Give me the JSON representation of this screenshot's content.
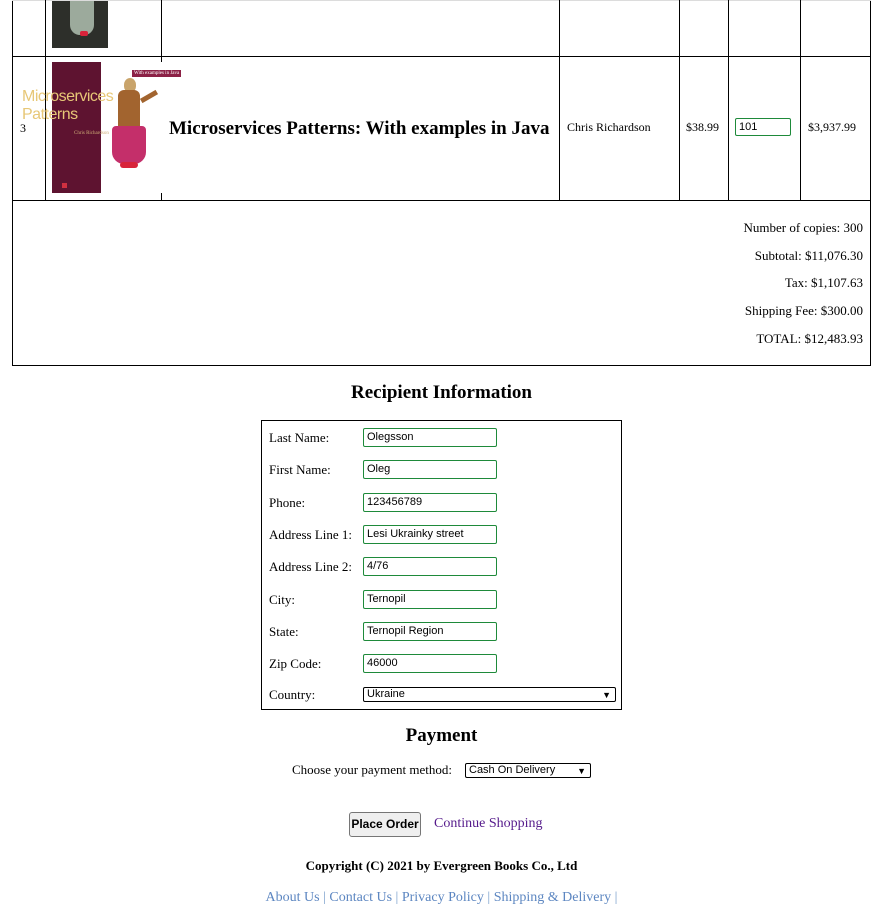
{
  "cart": {
    "items": [
      {
        "index": "3",
        "title": "Microservices Patterns: With examples in Java",
        "author": "Chris Richardson",
        "price": "$38.99",
        "quantity": "101",
        "subtotal": "$3,937.99",
        "cover": {
          "title_line1": "Microservices",
          "title_line2": "Patterns",
          "author": "Chris Richardson",
          "tagline": "With examples in Java",
          "colors": {
            "background": "#5e1330",
            "title": "#e7c777"
          }
        }
      }
    ],
    "totals": {
      "copies": "Number of copies: 300",
      "subtotal": "Subtotal: $11,076.30",
      "tax": "Tax: $1,107.63",
      "shipping": "Shipping Fee: $300.00",
      "total": "TOTAL: $12,483.93"
    }
  },
  "recipient": {
    "title": "Recipient Information",
    "fields": [
      {
        "label": "Last Name:",
        "value": "Olegsson"
      },
      {
        "label": "First Name:",
        "value": "Oleg"
      },
      {
        "label": "Phone:",
        "value": "123456789"
      },
      {
        "label": "Address Line 1:",
        "value": "Lesi Ukrainky street"
      },
      {
        "label": "Address Line 2:",
        "value": "4/76"
      },
      {
        "label": "City:",
        "value": "Ternopil"
      },
      {
        "label": "State:",
        "value": "Ternopil Region"
      },
      {
        "label": "Zip Code:",
        "value": "46000"
      }
    ],
    "country": {
      "label": "Country:",
      "value": "Ukraine"
    }
  },
  "payment": {
    "title": "Payment",
    "method_label": "Choose your payment method:",
    "method_value": "Cash On Delivery",
    "place_order": "Place Order",
    "continue_shopping": "Continue Shopping"
  },
  "footer": {
    "copyright": "Copyright (C) 2021 by Evergreen Books Co., Ltd",
    "links": [
      "About Us",
      "Contact Us",
      "Privacy Policy",
      "Shipping & Delivery"
    ],
    "separator": "|"
  },
  "colors": {
    "input_border": "#1e8a3a",
    "link": "#5c86c1",
    "visited_link": "#551a8b"
  }
}
